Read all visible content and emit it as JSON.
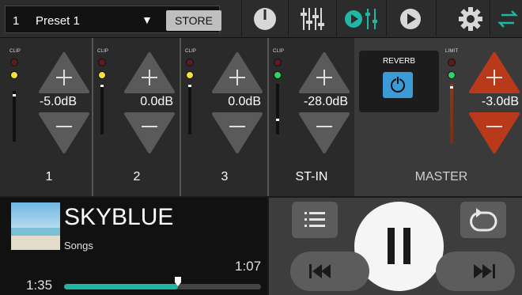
{
  "topbar": {
    "preset_number": "1",
    "preset_name": "Preset 1",
    "store_label": "STORE",
    "icons": [
      "meter-icon",
      "mixer-faders-icon",
      "play-eq-icon",
      "play-icon",
      "settings-gear-icon",
      "swap-arrows-icon"
    ]
  },
  "clip_label": "CLIP",
  "limit_label": "LIMIT",
  "channels": [
    {
      "name": "1",
      "level": "-5.0dB"
    },
    {
      "name": "2",
      "level": "0.0dB"
    },
    {
      "name": "3",
      "level": "0.0dB"
    },
    {
      "name": "ST-IN",
      "level": "-28.0dB"
    }
  ],
  "master": {
    "name": "MASTER",
    "level": "-3.0dB",
    "reverb_label": "REVERB"
  },
  "now_playing": {
    "title": "SKYBLUE",
    "subtitle": "Songs",
    "time_remaining": "1:07",
    "time_elapsed": "1:35",
    "progress": 0.58
  },
  "colors": {
    "accent_teal": "#1fb6a3",
    "master_red": "#b83a1a",
    "reverb_blue": "#3c9ad6"
  }
}
